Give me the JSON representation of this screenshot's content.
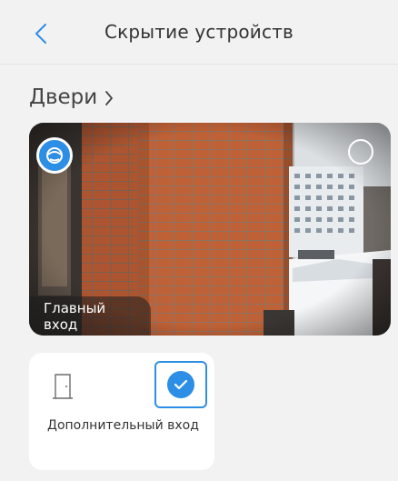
{
  "header": {
    "title": "Скрытие устройств",
    "back_icon": "chevron-left-icon"
  },
  "section": {
    "title": "Двери",
    "chevron_icon": "chevron-right-icon"
  },
  "camera": {
    "label": "Главный вход",
    "badge_icon": "face-recognition-icon",
    "selected": false
  },
  "device": {
    "label": "Дополнительный вход",
    "icon": "door-icon",
    "selected": true
  },
  "colors": {
    "accent": "#2d8ee6",
    "background": "#f2f2f2",
    "card": "#ffffff"
  }
}
